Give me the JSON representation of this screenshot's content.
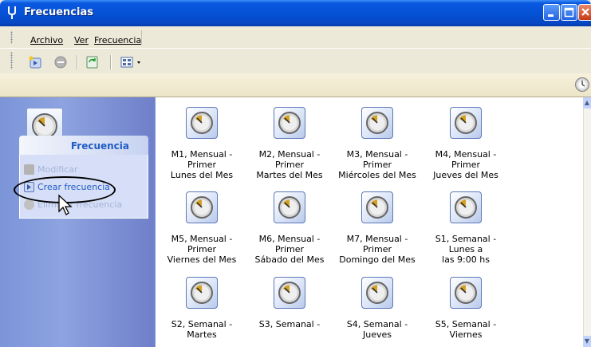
{
  "window": {
    "title": "Frecuencias",
    "app_icon": "tuning-fork-icon"
  },
  "menubar": {
    "items": [
      {
        "label": "Archivo"
      },
      {
        "label": "Ver"
      },
      {
        "label": "Frecuencia"
      }
    ]
  },
  "toolbar": {
    "buttons": [
      {
        "icon": "new-item-icon"
      },
      {
        "icon": "delete-icon"
      },
      {
        "icon": "refresh-icon"
      },
      {
        "icon": "view-mode-icon"
      }
    ]
  },
  "task_panel": {
    "title": "Frecuencia",
    "tasks": [
      {
        "label": "Modificar",
        "enabled": false
      },
      {
        "label": "Crear frecuencia",
        "enabled": true
      },
      {
        "label": "Eliminar frecuencia",
        "enabled": false
      }
    ]
  },
  "items": [
    {
      "line1": "M1, Mensual - Primer",
      "line2": "Lunes del Mes"
    },
    {
      "line1": "M2, Mensual - Primer",
      "line2": "Martes del Mes"
    },
    {
      "line1": "M3, Mensual - Primer",
      "line2": "Miércoles del Mes"
    },
    {
      "line1": "M4, Mensual - Primer",
      "line2": "Jueves del Mes"
    },
    {
      "line1": "M5, Mensual - Primer",
      "line2": "Viernes del Mes"
    },
    {
      "line1": "M6, Mensual - Primer",
      "line2": "Sábado del Mes"
    },
    {
      "line1": "M7, Mensual - Primer",
      "line2": "Domingo del Mes"
    },
    {
      "line1": "S1, Semanal - Lunes a",
      "line2": "las 9:00 hs"
    },
    {
      "line1": "S2, Semanal - Martes",
      "line2": ""
    },
    {
      "line1": "S3, Semanal -",
      "line2": ""
    },
    {
      "line1": "S4, Semanal - Jueves",
      "line2": ""
    },
    {
      "line1": "S5, Semanal - Viernes",
      "line2": ""
    }
  ],
  "colors": {
    "title_bar": "#0552d6",
    "task_link": "#215dc6",
    "task_disabled": "#a7b4d8"
  }
}
